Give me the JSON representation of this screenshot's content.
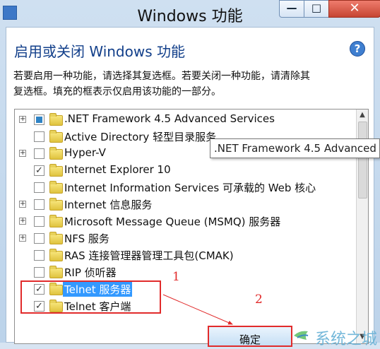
{
  "window": {
    "title": "Windows 功能",
    "buttons": {
      "minimize": "—",
      "maximize": "□",
      "close": "✕"
    }
  },
  "header": {
    "title": "启用或关闭 Windows 功能",
    "help": "?"
  },
  "description": [
    "若要启用一种功能，请选择其复选框。若要关闭一种功能，请清除其",
    "复选框。填充的框表示仅启用该功能的一部分。"
  ],
  "features": [
    {
      "label": ".NET Framework 4.5 Advanced Services",
      "expander": "+",
      "check": "partial"
    },
    {
      "label": "Active Directory 轻型目录服务",
      "expander": "",
      "check": "unchecked"
    },
    {
      "label": "Hyper-V",
      "expander": "+",
      "check": "unchecked"
    },
    {
      "label": "Internet Explorer 10",
      "expander": "",
      "check": "checked"
    },
    {
      "label": "Internet Information Services 可承载的 Web 核心",
      "expander": "",
      "check": "unchecked"
    },
    {
      "label": "Internet 信息服务",
      "expander": "+",
      "check": "unchecked"
    },
    {
      "label": "Microsoft Message Queue (MSMQ) 服务器",
      "expander": "+",
      "check": "unchecked"
    },
    {
      "label": "NFS 服务",
      "expander": "+",
      "check": "unchecked"
    },
    {
      "label": "RAS 连接管理器管理工具包(CMAK)",
      "expander": "",
      "check": "unchecked"
    },
    {
      "label": "RIP 侦听器",
      "expander": "",
      "check": "unchecked"
    },
    {
      "label": "Telnet 服务器",
      "expander": "",
      "check": "checked",
      "selected": true
    },
    {
      "label": "Telnet 客户端",
      "expander": "",
      "check": "checked"
    }
  ],
  "tooltip": {
    "text": ".NET Framework 4.5 Advanced"
  },
  "annotations": {
    "one": "1",
    "two": "2"
  },
  "footer": {
    "ok": "确定"
  },
  "watermark": {
    "text": "系统之城"
  },
  "colors": {
    "accent": "#3399ff",
    "annotation": "#e12b2b",
    "heading": "#123f8a"
  }
}
